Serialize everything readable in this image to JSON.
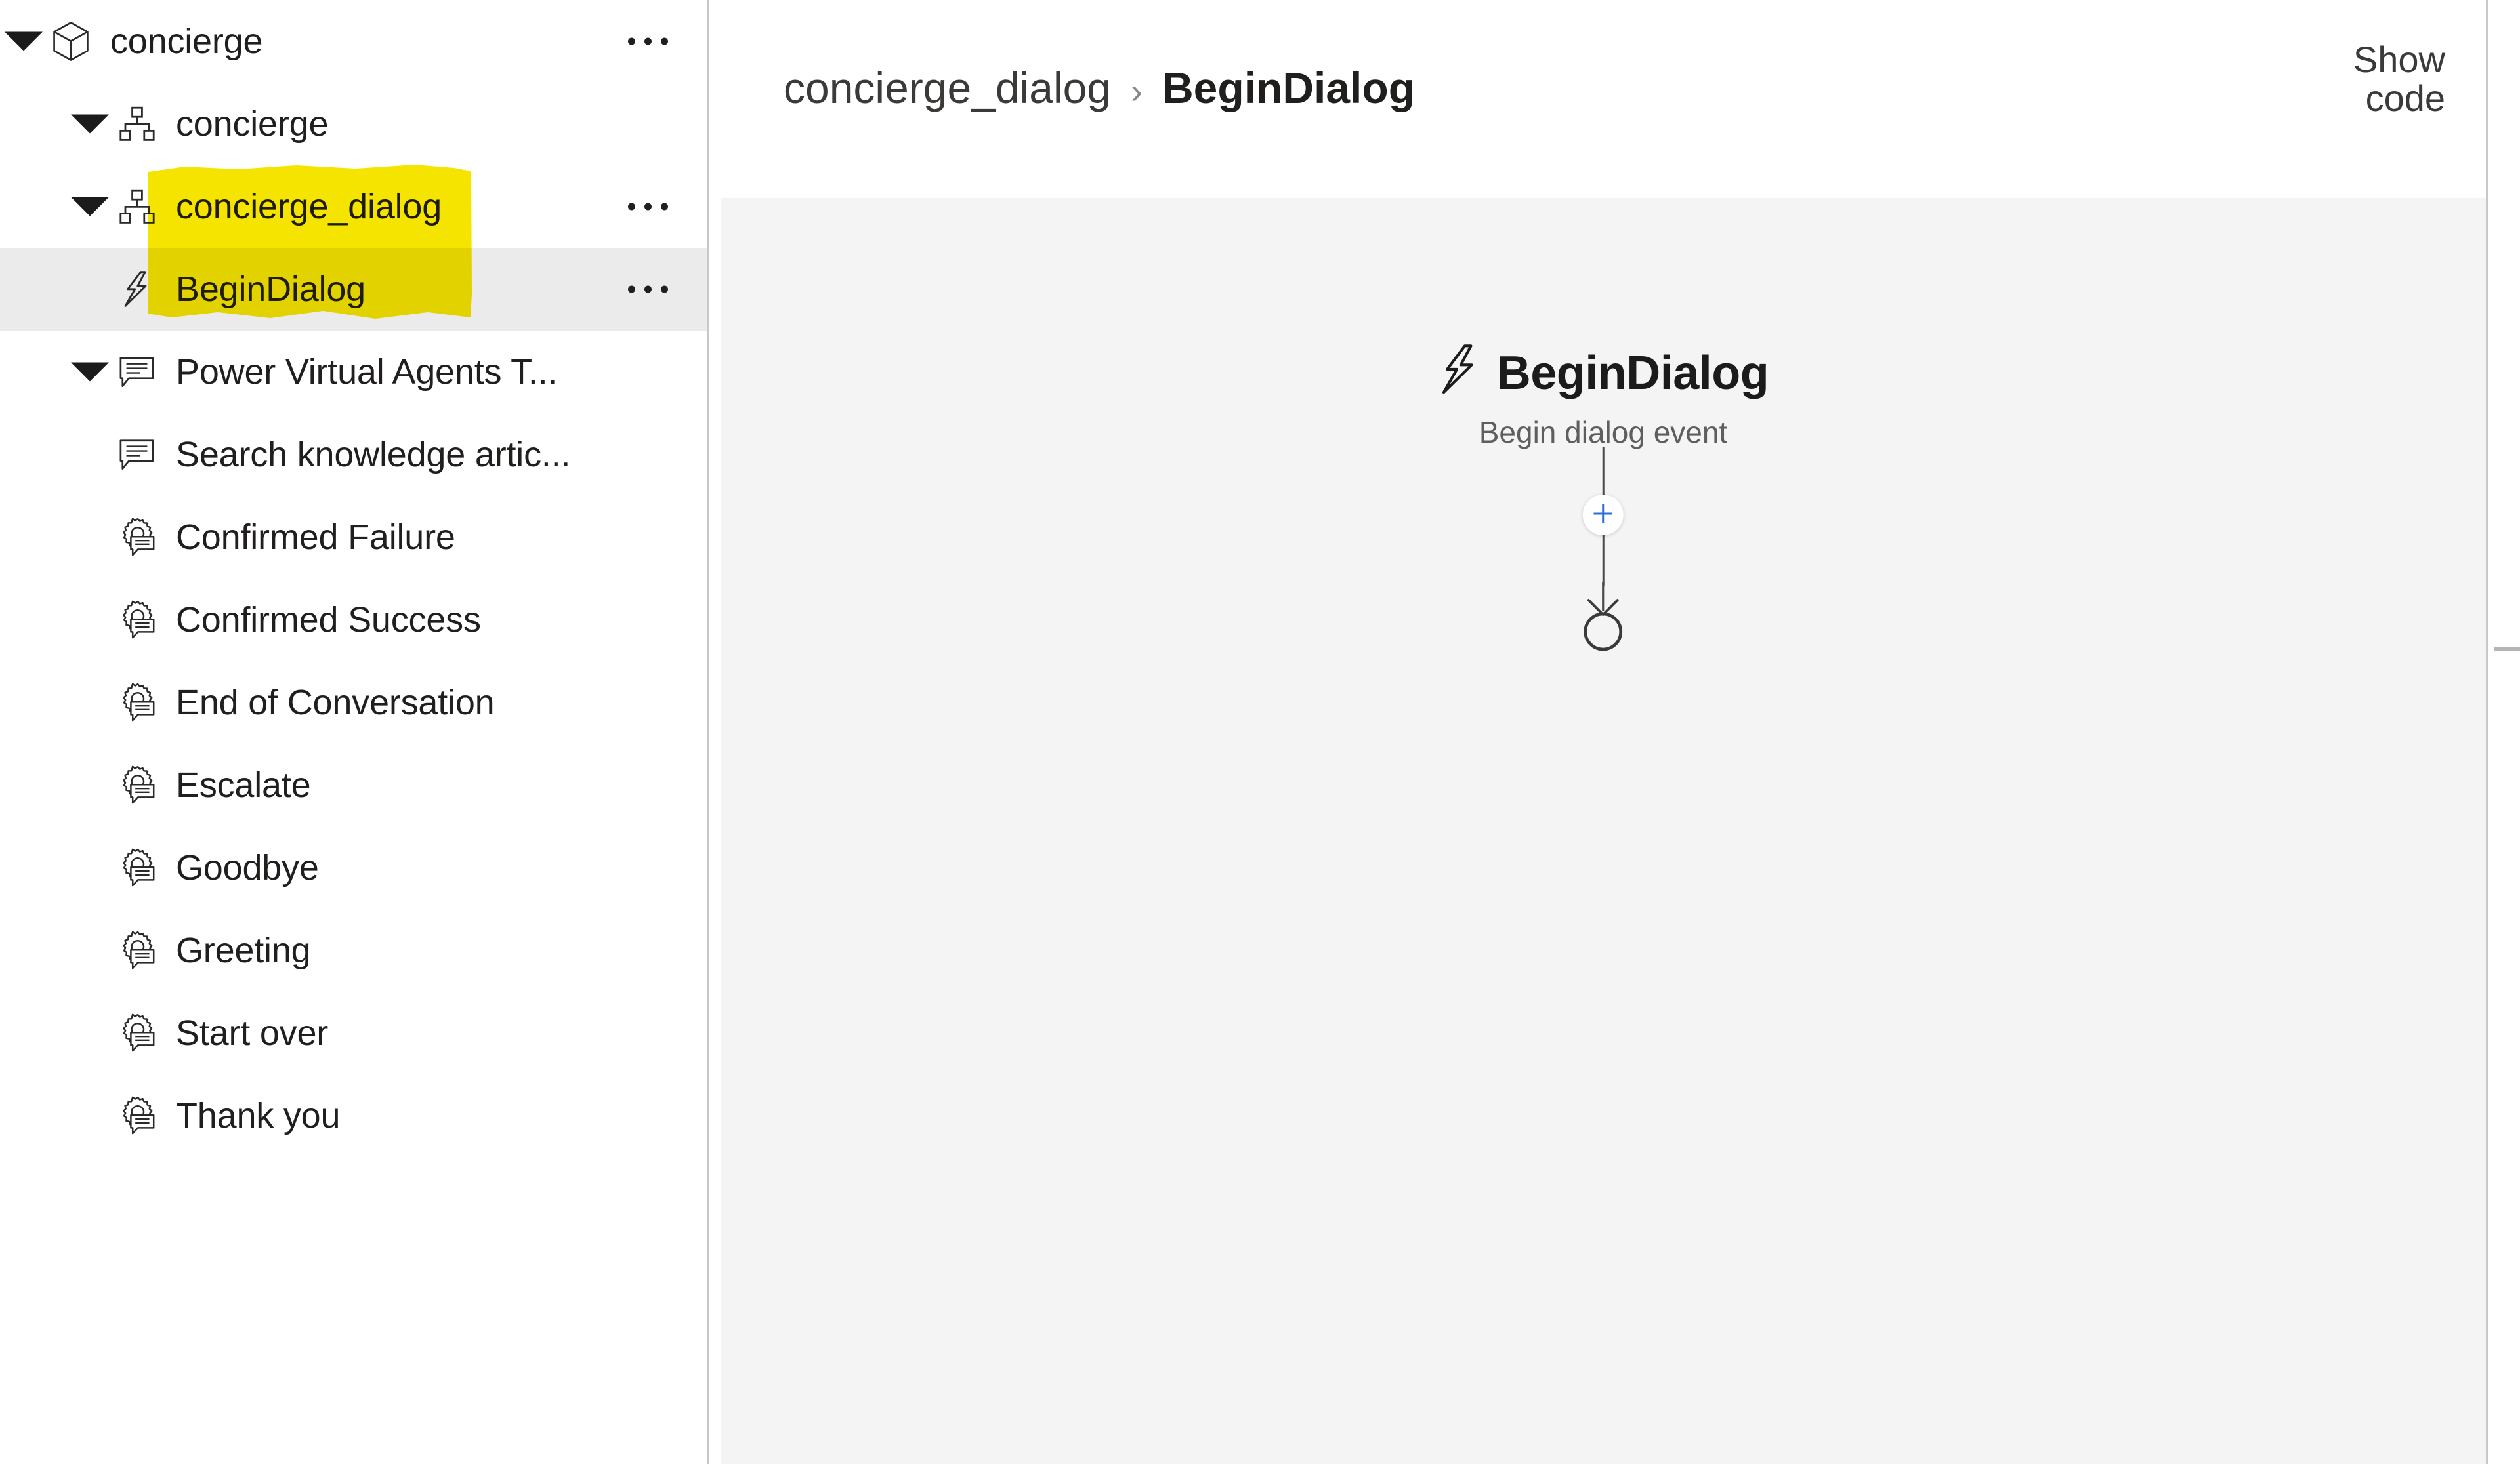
{
  "project_tree": {
    "items": [
      {
        "label": "concierge",
        "icon": "cube-icon",
        "depth": 0,
        "expanded": true,
        "has_chevron": true,
        "has_more": true,
        "selected": false
      },
      {
        "label": "concierge",
        "icon": "hierarchy-icon",
        "depth": 1,
        "expanded": true,
        "has_chevron": true,
        "has_more": false,
        "selected": false
      },
      {
        "label": "concierge_dialog",
        "icon": "hierarchy-icon",
        "depth": 1,
        "expanded": true,
        "has_chevron": true,
        "has_more": true,
        "selected": false
      },
      {
        "label": "BeginDialog",
        "icon": "lightning-bolt-icon",
        "depth": 2,
        "expanded": false,
        "has_chevron": false,
        "has_more": true,
        "selected": true
      },
      {
        "label": "Power Virtual Agents T...",
        "icon": "dialog-message-icon",
        "depth": 1,
        "expanded": true,
        "has_chevron": true,
        "has_more": false,
        "selected": false
      },
      {
        "label": "Search knowledge artic...",
        "icon": "dialog-message-icon",
        "depth": 2,
        "expanded": false,
        "has_chevron": false,
        "has_more": false,
        "selected": false
      },
      {
        "label": "Confirmed Failure",
        "icon": "gear-message-icon",
        "depth": 2,
        "expanded": false,
        "has_chevron": false,
        "has_more": false,
        "selected": false
      },
      {
        "label": "Confirmed Success",
        "icon": "gear-message-icon",
        "depth": 2,
        "expanded": false,
        "has_chevron": false,
        "has_more": false,
        "selected": false
      },
      {
        "label": "End of Conversation",
        "icon": "gear-message-icon",
        "depth": 2,
        "expanded": false,
        "has_chevron": false,
        "has_more": false,
        "selected": false
      },
      {
        "label": "Escalate",
        "icon": "gear-message-icon",
        "depth": 2,
        "expanded": false,
        "has_chevron": false,
        "has_more": false,
        "selected": false
      },
      {
        "label": "Goodbye",
        "icon": "gear-message-icon",
        "depth": 2,
        "expanded": false,
        "has_chevron": false,
        "has_more": false,
        "selected": false
      },
      {
        "label": "Greeting",
        "icon": "gear-message-icon",
        "depth": 2,
        "expanded": false,
        "has_chevron": false,
        "has_more": false,
        "selected": false
      },
      {
        "label": "Start over",
        "icon": "gear-message-icon",
        "depth": 2,
        "expanded": false,
        "has_chevron": false,
        "has_more": false,
        "selected": false
      },
      {
        "label": "Thank you",
        "icon": "gear-message-icon",
        "depth": 2,
        "expanded": false,
        "has_chevron": false,
        "has_more": false,
        "selected": false
      }
    ]
  },
  "annotation": {
    "type": "marker-highlight",
    "color": "#f5e400",
    "covers": [
      "concierge_dialog",
      "BeginDialog"
    ]
  },
  "header": {
    "breadcrumb": {
      "parent": "concierge_dialog",
      "separator": "›",
      "current": "BeginDialog"
    },
    "show_code_label_line1": "Show",
    "show_code_label_line2": "code"
  },
  "canvas": {
    "background_color": "#f4f4f4",
    "trigger": {
      "icon": "lightning-bolt-icon",
      "title": "BeginDialog",
      "subtitle": "Begin dialog event"
    },
    "add_node": {
      "icon": "plus-icon",
      "color": "#2b6fd4"
    },
    "end_node": {
      "icon": "end-circle-icon"
    }
  }
}
